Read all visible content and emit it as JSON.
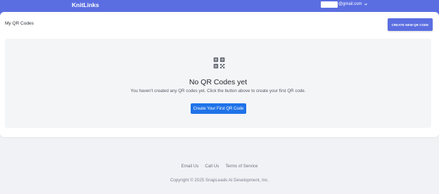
{
  "header": {
    "brand": "KnitLinks",
    "account_domain": "@gmail.com"
  },
  "main": {
    "page_title": "My QR Codes",
    "create_button_label": "CREATE NEW QR CODE",
    "empty_state": {
      "icon": "qr-code-icon",
      "title": "No QR Codes yet",
      "description": "You haven't created any QR codes yet. Click the button above to create your first QR code.",
      "button_label": "Create Your First QR Code"
    }
  },
  "footer": {
    "links": [
      "Email Us",
      "Call Us",
      "Terms of Service"
    ],
    "copyright": "Copyright © 2025 SnapLeads AI Development, Inc."
  },
  "colors": {
    "header_bg": "#5b6ee1",
    "primary_button": "#1f73e8",
    "page_bg": "#f1f2f5"
  }
}
